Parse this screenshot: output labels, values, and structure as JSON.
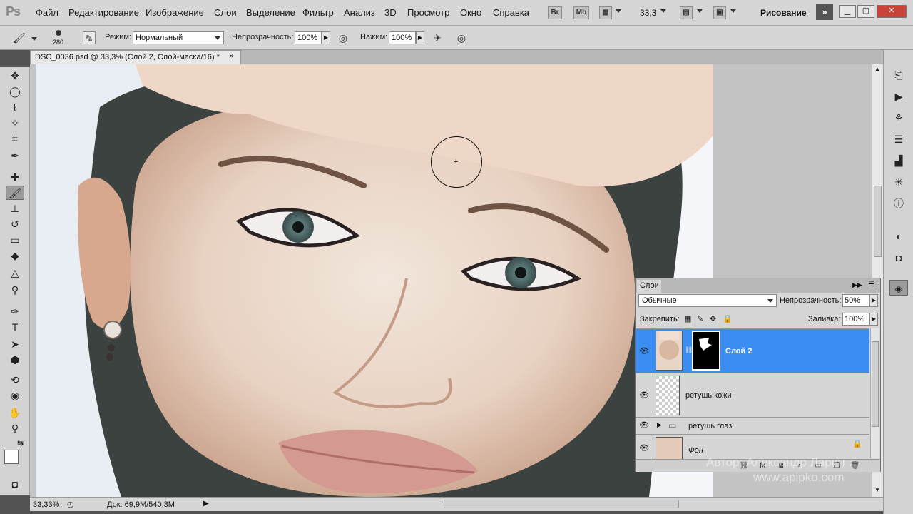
{
  "menubar": {
    "logo": "Ps",
    "items": [
      "Файл",
      "Редактирование",
      "Изображение",
      "Слои",
      "Выделение",
      "Фильтр",
      "Анализ",
      "3D",
      "Просмотр",
      "Окно",
      "Справка"
    ],
    "bridge_label": "Br",
    "minibridge_label": "Mb",
    "zoom": "33,3",
    "workspace": "Рисование",
    "more_label": "»"
  },
  "options": {
    "brush_size": "280",
    "mode_label": "Режим:",
    "mode_value": "Нормальный",
    "opacity_label": "Непрозрачность:",
    "opacity_value": "100%",
    "pressure_label": "Нажим:",
    "pressure_value": "100%"
  },
  "document": {
    "title": "DSC_0036.psd @ 33,3% (Слой 2, Слой-маска/16) *",
    "close_label": "×"
  },
  "status": {
    "zoom": "33,33%",
    "doc_info": "Док: 69,9M/540,3M"
  },
  "layers_panel": {
    "tab": "Слои",
    "blend_mode": "Обычные",
    "opacity_label": "Непрозрачность:",
    "opacity_value": "50%",
    "lock_label": "Закрепить:",
    "fill_label": "Заливка:",
    "fill_value": "100%",
    "layers": [
      {
        "name": "Слой 2",
        "selected": true
      },
      {
        "name": "ретушь кожи",
        "selected": false
      },
      {
        "name": "ретушь глаз",
        "selected": false
      },
      {
        "name": "Фон",
        "selected": false
      }
    ]
  },
  "watermark": {
    "line1": "Автор: Александр Ларин",
    "line2": "www.apipko.com"
  },
  "colors": {
    "selection": "#3b8df2",
    "chrome": "#d6d6d6",
    "close": "#c8443a"
  }
}
